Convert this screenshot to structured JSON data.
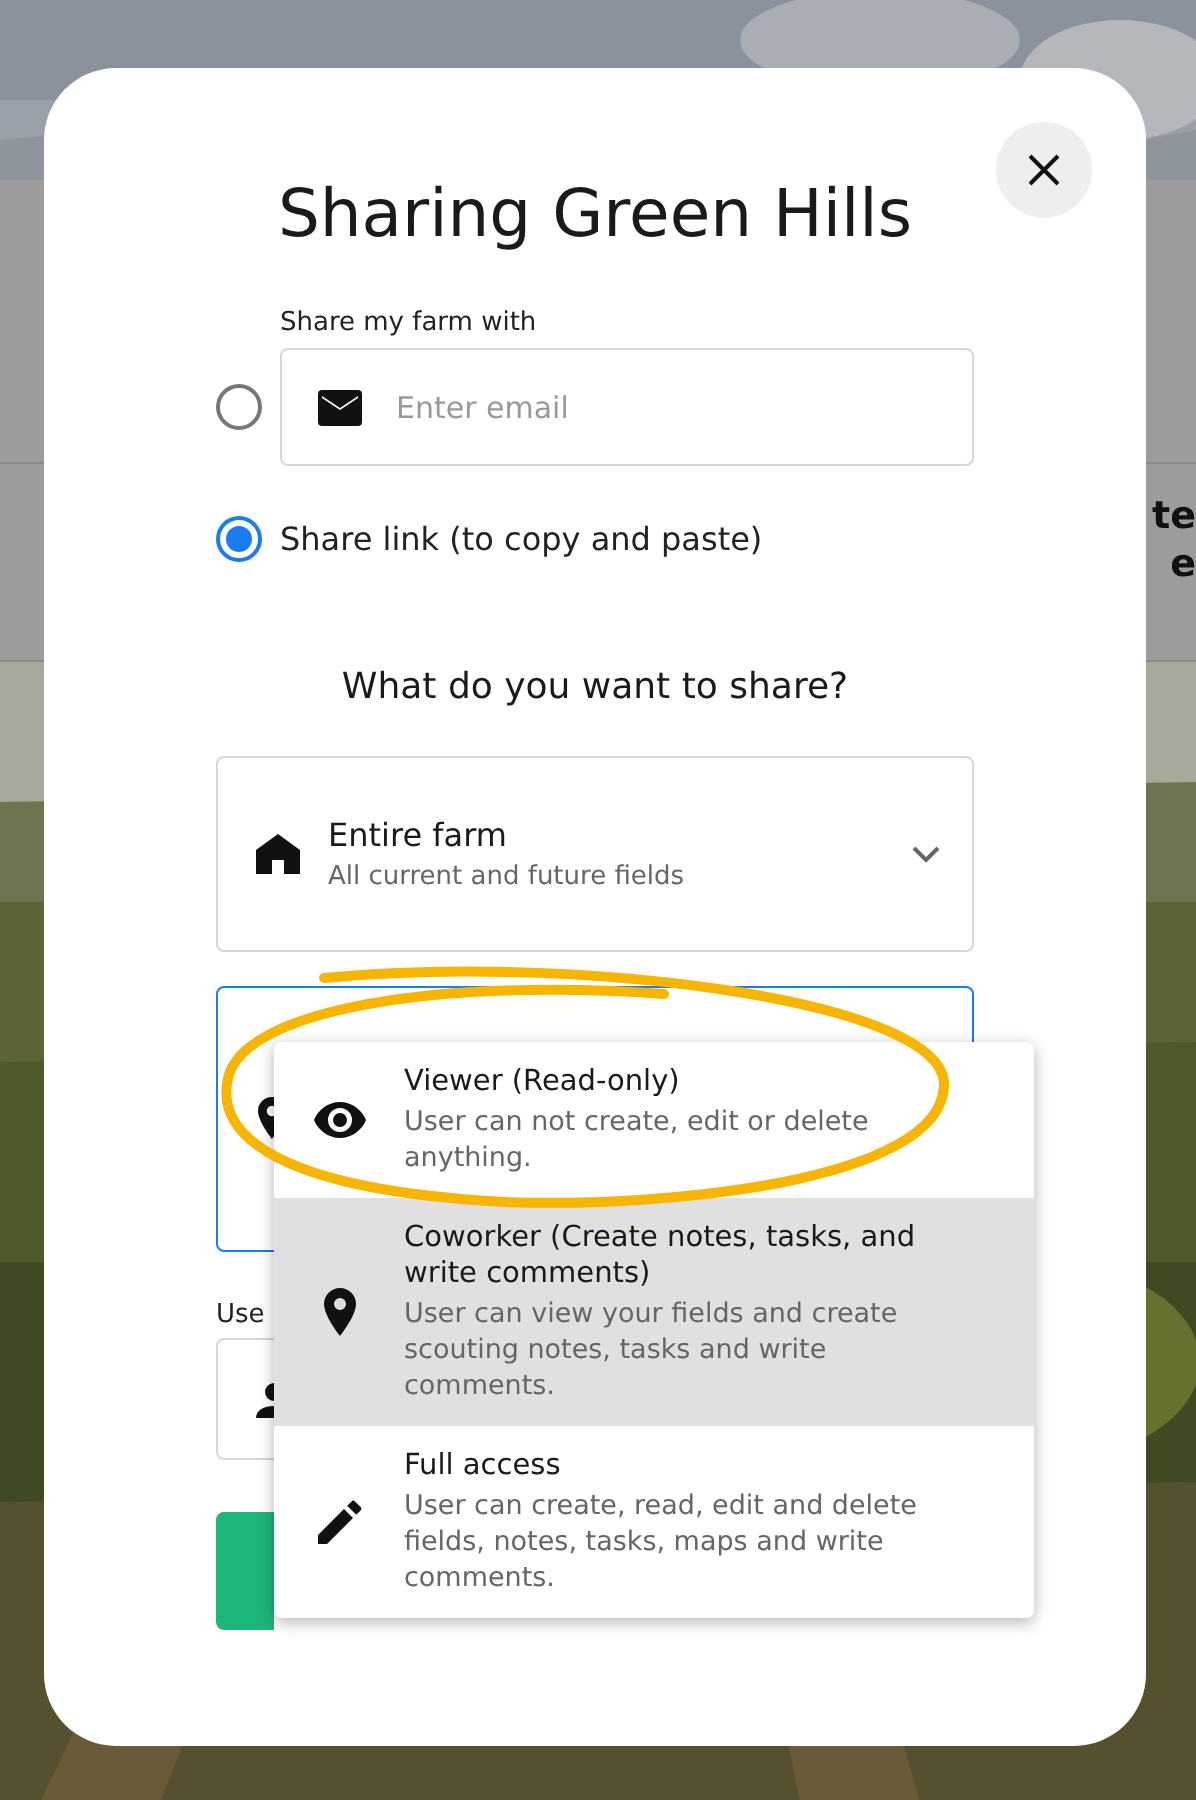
{
  "background": {
    "fragments": [
      "te",
      "e"
    ]
  },
  "dialog": {
    "title": "Sharing Green Hills",
    "recipient_label": "Share my farm with",
    "email": {
      "placeholder": "Enter email"
    },
    "share_options": [
      {
        "kind": "email",
        "selected": false
      },
      {
        "kind": "link",
        "label": "Share link (to copy and paste)",
        "selected": true
      }
    ],
    "heading": "What do you want to share?",
    "scope_select": {
      "title": "Entire farm",
      "subtitle": "All current and future fields"
    },
    "user_label": "Use",
    "role_menu": [
      {
        "kind": "viewer",
        "title": "Viewer (Read-only)",
        "description": "User can not create, edit or delete anything.",
        "highlighted": false
      },
      {
        "kind": "coworker",
        "title": "Coworker (Create notes, tasks, and write comments)",
        "description": "User can view your fields and create scouting notes, tasks and write comments.",
        "highlighted": true
      },
      {
        "kind": "full",
        "title": "Full access",
        "description": "User can create, read, edit and delete fields, notes, tasks, maps and write comments.",
        "highlighted": false
      }
    ]
  }
}
